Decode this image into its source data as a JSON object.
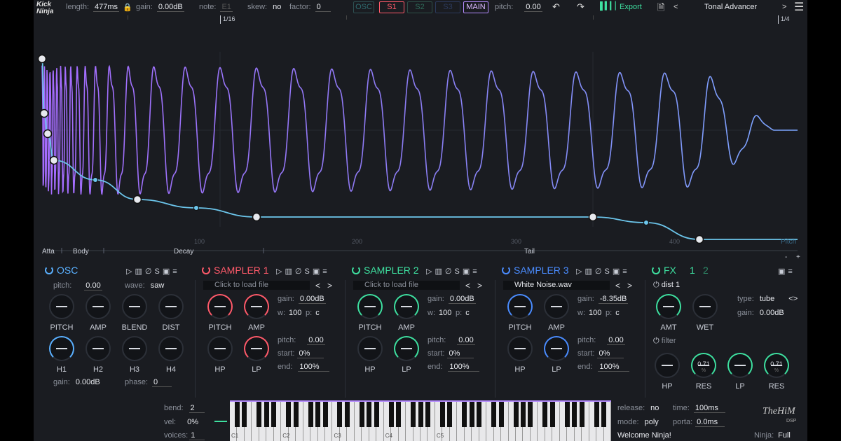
{
  "topbar": {
    "logo": "Kick Ninja",
    "length_label": "length:",
    "length_value": "477ms",
    "gain_label": "gain:",
    "gain_value": "0.00dB",
    "note_label": "note:",
    "note_value": "E1",
    "skew_label": "skew:",
    "skew_value": "no",
    "factor_label": "factor:",
    "factor_value": "0",
    "modes": [
      "OSC",
      "S1",
      "S2",
      "S3",
      "MAIN"
    ],
    "pitch_label": "pitch:",
    "pitch_value": "0.00",
    "export_label": "Export",
    "preset_name": "Tonal Advancer",
    "prev": "<",
    "next": ">"
  },
  "ruler": {
    "left_mark": "1/16",
    "right_mark": "1/4"
  },
  "graph": {
    "x_ticks": [
      "100",
      "200",
      "300",
      "400"
    ],
    "segments": [
      "Atta",
      "Body",
      "Decay",
      "Tail"
    ],
    "pitch_label": "Pitch",
    "colors": {
      "wave": "#8c7cf0",
      "envelope": "#5ec3ea"
    }
  },
  "osc": {
    "title": "OSC",
    "pitch_label": "pitch:",
    "pitch_value": "0.00",
    "wave_label": "wave:",
    "wave_value": "saw",
    "knobs": [
      "PITCH",
      "AMP",
      "BLEND",
      "DIST",
      "H1",
      "H2",
      "H3",
      "H4"
    ],
    "gain_label": "gain:",
    "gain_value": "0.00dB",
    "phase_label": "phase:",
    "phase_value": "0",
    "color": "#5ab0ff"
  },
  "s1": {
    "title": "SAMPLER 1",
    "file": "Click to load file",
    "gain_label": "gain:",
    "gain_value": "0.00dB",
    "w_label": "w:",
    "w_value": "100",
    "p_label": "p:",
    "p_value": "c",
    "knobs": [
      "PITCH",
      "AMP",
      "HP",
      "LP"
    ],
    "pitch_label": "pitch:",
    "pitch_value": "0.00",
    "start_label": "start:",
    "start_value": "0%",
    "end_label": "end:",
    "end_value": "100%",
    "color": "#ff5a6a"
  },
  "s2": {
    "title": "SAMPLER 2",
    "file": "Click to load file",
    "gain_label": "gain:",
    "gain_value": "0.00dB",
    "w_label": "w:",
    "w_value": "100",
    "p_label": "p:",
    "p_value": "c",
    "knobs": [
      "PITCH",
      "AMP",
      "HP",
      "LP"
    ],
    "pitch_label": "pitch:",
    "pitch_value": "0.00",
    "start_label": "start:",
    "start_value": "0%",
    "end_label": "end:",
    "end_value": "100%",
    "color": "#3ee0a0"
  },
  "s3": {
    "title": "SAMPLER 3",
    "file": "White Noise.wav",
    "gain_label": "gain:",
    "gain_value": "-8.35dB",
    "w_label": "w:",
    "w_value": "100",
    "p_label": "p:",
    "p_value": "c",
    "knobs": [
      "PITCH",
      "AMP",
      "HP",
      "LP"
    ],
    "pitch_label": "pitch:",
    "pitch_value": "0.00",
    "start_label": "start:",
    "start_value": "0%",
    "end_label": "end:",
    "end_value": "100%",
    "color": "#4a8cff"
  },
  "fx": {
    "title": "FX",
    "tab1": "1",
    "tab2": "2",
    "dist_label": "dist 1",
    "type_label": "type:",
    "type_value": "tube",
    "gain_label": "gain:",
    "gain_value": "0.00dB",
    "knob_amt": "AMT",
    "knob_wet": "WET",
    "filter_label": "filter",
    "res_value": "0.71",
    "res_unit": "%",
    "knob_hp": "HP",
    "knob_res": "RES",
    "knob_lp": "LP",
    "knob_res2": "RES",
    "color": "#3ee0a0"
  },
  "bottom": {
    "bend_label": "bend:",
    "bend_value": "2",
    "vel_label": "vel:",
    "vel_value": "0%",
    "voices_label": "voices:",
    "voices_value": "1",
    "octaves": [
      "C1",
      "C2",
      "C3",
      "C4",
      "C5"
    ],
    "release_label": "release:",
    "release_value": "no",
    "time_label": "time:",
    "time_value": "100ms",
    "mode_label": "mode:",
    "mode_value": "poly",
    "porta_label": "porta:",
    "porta_value": "0.0ms",
    "status": "Welcome Ninja!",
    "brand": "TheHiM",
    "brand_sub": "DSP",
    "ninja_label": "Ninja:",
    "ninja_value": "Full"
  }
}
